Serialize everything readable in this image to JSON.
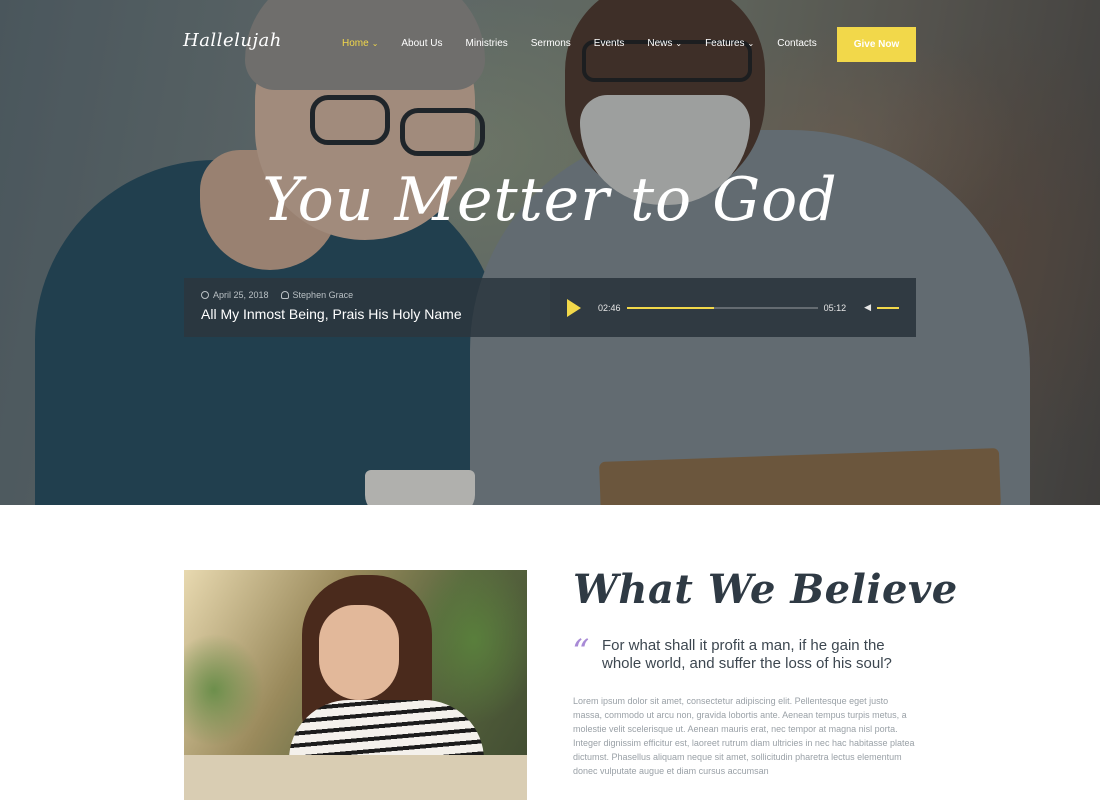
{
  "brand": {
    "logo_text": "Hallelujah",
    "accent_color": "#f2d84a"
  },
  "nav": {
    "items": [
      {
        "label": "Home",
        "caret": "⌄",
        "active": true
      },
      {
        "label": "About Us"
      },
      {
        "label": "Ministries"
      },
      {
        "label": "Sermons"
      },
      {
        "label": "Events"
      },
      {
        "label": "News",
        "caret": "⌄"
      },
      {
        "label": "Features",
        "caret": "⌄"
      },
      {
        "label": "Contacts"
      }
    ],
    "cta_label": "Give Now"
  },
  "hero": {
    "title": "You Metter to God"
  },
  "player": {
    "date": "April 25, 2018",
    "author": "Stephen Grace",
    "track_title": "All My Inmost Being, Prais His Holy Name",
    "current_time": "02:46",
    "total_time": "05:12",
    "progress_fraction": 0.46,
    "volume_fraction": 1.0,
    "play_icon": "play-icon",
    "volume_icon": "volume-icon"
  },
  "believe": {
    "title": "What We Believe",
    "quote_mark": "“",
    "quote": "For what shall it profit a man, if he gain the whole world, and suffer the loss of his soul?",
    "body": "Lorem ipsum dolor sit amet, consectetur adipiscing elit. Pellentesque eget justo massa, commodo ut arcu non, gravida lobortis ante. Aenean tempus turpis metus, a molestie velit scelerisque ut. Aenean mauris erat, nec tempor at magna nisl porta. Integer dignissim efficitur est, laoreet rutrum diam ultricies in nec hac habitasse platea dictumst. Phasellus aliquam neque sit amet, sollicitudin pharetra lectus elementum donec vulputate augue et diam cursus accumsan"
  }
}
